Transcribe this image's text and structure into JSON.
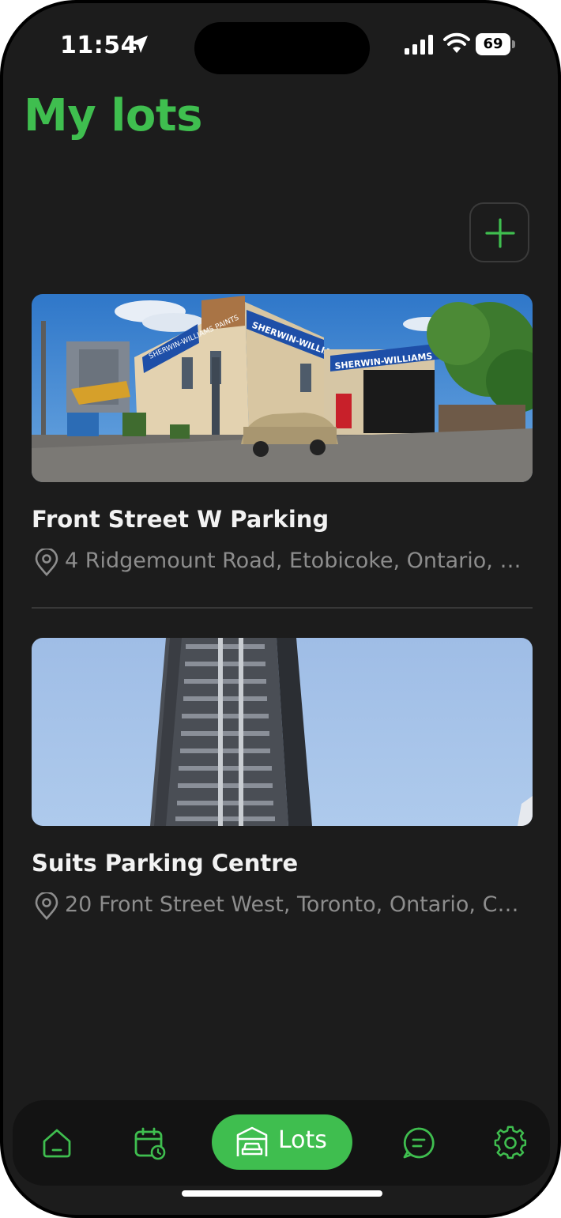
{
  "status_bar": {
    "time": "11:54",
    "battery": "69"
  },
  "header": {
    "title": "My lots"
  },
  "lots": [
    {
      "name": "Front Street W Parking",
      "address": "4 Ridgemount Road, Etobicoke, Ontario, Canada",
      "sign_text_1": "SHERWIN-WILLIAMS",
      "sign_text_2": "SHERWIN-WILLIAMS PAINTS"
    },
    {
      "name": "Suits Parking Centre",
      "address": "20 Front Street West, Toronto, Ontario, Canada"
    }
  ],
  "tab_bar": {
    "lots_label": "Lots"
  },
  "colors": {
    "accent": "#3fbe4f",
    "background": "#1c1c1c",
    "tab_bar": "#131313"
  },
  "icons": [
    "location-arrow-icon",
    "signal-icon",
    "wifi-icon",
    "battery-icon",
    "plus-icon",
    "map-pin-icon",
    "home-icon",
    "calendar-clock-icon",
    "garage-car-icon",
    "chat-icon",
    "gear-icon"
  ]
}
